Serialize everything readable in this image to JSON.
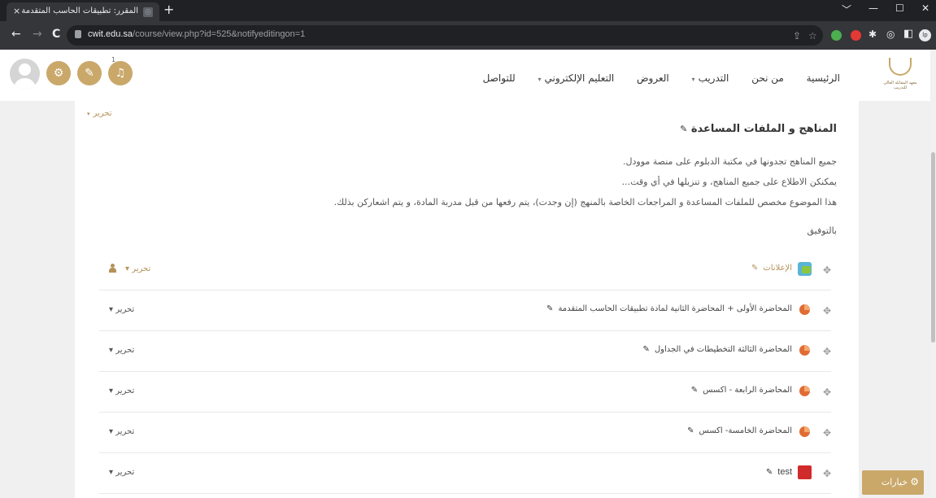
{
  "browser": {
    "tab_title": "المقرر: تطبيقات الحاسب المتقدمة",
    "tab_close": "×",
    "new_tab": "+",
    "back": "←",
    "forward": "→",
    "reload": "C",
    "url_host": "cwit.edu.sa",
    "url_path": "/course/view.php?id=525&notifyeditingon=1",
    "window_controls": [
      "﹀",
      "—",
      "☐",
      "✕"
    ],
    "extension_avatar": "lp"
  },
  "header": {
    "logo_text": "معهد المقابلة العالي للتدريب",
    "nav": [
      {
        "label": "الرئيسية",
        "has_caret": false
      },
      {
        "label": "من نحن",
        "has_caret": false
      },
      {
        "label": "التدريب",
        "has_caret": true
      },
      {
        "label": "العروض",
        "has_caret": false
      },
      {
        "label": "التعليم الإلكتروني",
        "has_caret": true
      },
      {
        "label": "للتواصل",
        "has_caret": false
      }
    ],
    "notif_count": "1",
    "icons": [
      "settings-icon",
      "chat-icon",
      "bell-icon",
      "user-avatar"
    ]
  },
  "section": {
    "edit_link": "تحرير",
    "title": "المناهج و الملفات المساعدة",
    "paragraphs": [
      "جميع المناهج تجدونها في مكتبة الدبلوم على منصة موودل.",
      "يمكنكن الاطلاع على جميع المناهج، و تنزيلها في أي وقت...",
      "هذا الموضوع مخصص للملفات المساعدة و المراجعات الخاصة بالمنهج (إن وجدت)، يتم رفعها من قبل مدربة المادة، و يتم اشعاركن بذلك.",
      "بالتوفيق"
    ]
  },
  "activities": [
    {
      "label": "الإعلانات",
      "icon": "forum",
      "muted": true,
      "edit": "تحرير",
      "edit_gold": true,
      "person": true
    },
    {
      "label": "المحاضرة الأولى + المحاضرة الثانية لمادة تطبيقات الحاسب المتقدمة",
      "icon": "ppt",
      "muted": false,
      "edit": "تحرير",
      "edit_gold": false,
      "person": false
    },
    {
      "label": "المحاضرة الثالثة التخطيطات في الجداول",
      "icon": "ppt",
      "muted": false,
      "edit": "تحرير",
      "edit_gold": false,
      "person": false
    },
    {
      "label": "المحاضرة الرابعة - اكسس",
      "icon": "ppt",
      "muted": false,
      "edit": "تحرير",
      "edit_gold": false,
      "person": false
    },
    {
      "label": "المحاضرة الخامسة- اكسس",
      "icon": "ppt",
      "muted": false,
      "edit": "تحرير",
      "edit_gold": false,
      "person": false
    },
    {
      "label": "test",
      "icon": "pdf",
      "muted": false,
      "edit": "تحرير",
      "edit_gold": false,
      "person": false
    }
  ],
  "options_button": "خيارات",
  "colors": {
    "accent": "#c9a86a",
    "link": "#b5925a"
  }
}
